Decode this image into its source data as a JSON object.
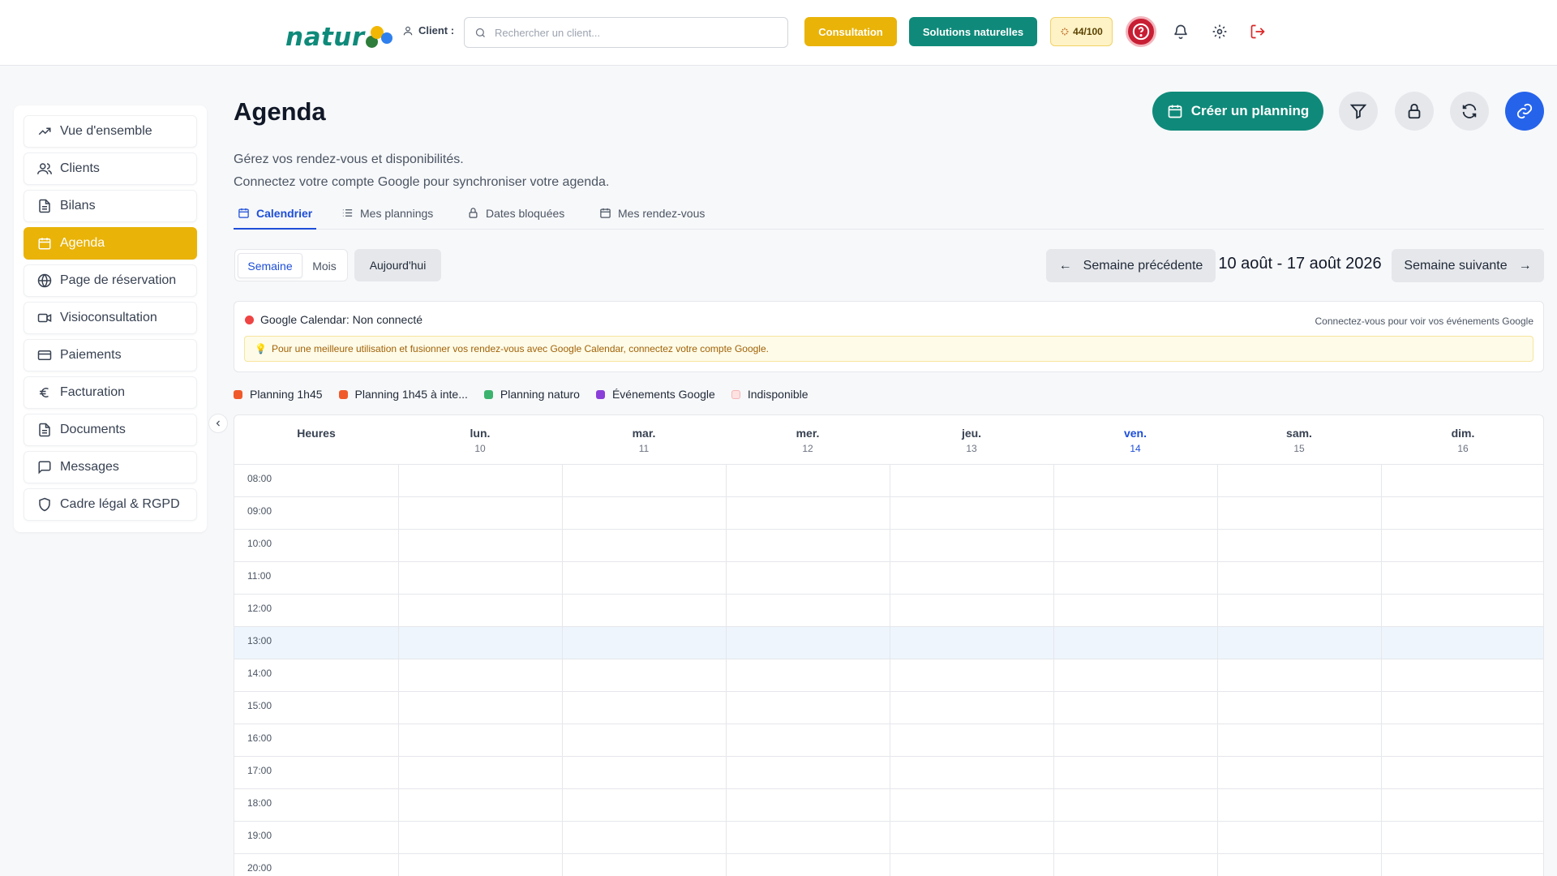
{
  "header": {
    "logo_text": "natur",
    "client_label": "Client :",
    "search_placeholder": "Rechercher un client...",
    "consultation_label": "Consultation",
    "solutions_label": "Solutions naturelles",
    "score": "44/100",
    "colors": {
      "brand_teal": "#0f8a7a",
      "brand_yellow": "#e9b308",
      "help_red": "#c81e34"
    }
  },
  "sidebar": {
    "items": [
      {
        "label": "Vue d'ensemble",
        "icon": "trending-up-icon"
      },
      {
        "label": "Clients",
        "icon": "users-icon"
      },
      {
        "label": "Bilans",
        "icon": "document-icon"
      },
      {
        "label": "Agenda",
        "icon": "calendar-icon",
        "active": true
      },
      {
        "label": "Page de réservation",
        "icon": "globe-icon"
      },
      {
        "label": "Visioconsultation",
        "icon": "video-icon"
      },
      {
        "label": "Paiements",
        "icon": "credit-card-icon"
      },
      {
        "label": "Facturation",
        "icon": "euro-icon"
      },
      {
        "label": "Documents",
        "icon": "document-icon"
      },
      {
        "label": "Messages",
        "icon": "message-icon"
      },
      {
        "label": "Cadre légal & RGPD",
        "icon": "shield-icon"
      }
    ]
  },
  "main": {
    "title": "Agenda",
    "subtitle_1": "Gérez vos rendez-vous et disponibilités.",
    "subtitle_2": "Connectez votre compte Google pour synchroniser votre agenda.",
    "create_label": "Créer un planning",
    "tabs": [
      {
        "label": "Calendrier",
        "icon": "calendar-icon",
        "active": true
      },
      {
        "label": "Mes plannings",
        "icon": "list-icon"
      },
      {
        "label": "Dates bloquées",
        "icon": "lock-icon"
      },
      {
        "label": "Mes rendez-vous",
        "icon": "calendar-icon"
      }
    ],
    "view": {
      "week": "Semaine",
      "month": "Mois",
      "selected": "Semaine",
      "today": "Aujourd'hui"
    },
    "nav": {
      "prev": "Semaine précédente",
      "next": "Semaine suivante",
      "range": "10 août - 17 août 2026"
    },
    "google": {
      "status": "Google Calendar: Non connecté",
      "hint": "Connectez-vous pour voir vos événements Google",
      "tip": "Pour une meilleure utilisation et fusionner vos rendez-vous avec Google Calendar, connectez votre compte Google."
    },
    "legend": [
      {
        "label": "Planning 1h45",
        "color": "#f05a2b"
      },
      {
        "label": "Planning 1h45 à inte...",
        "color": "#f05a2b"
      },
      {
        "label": "Planning naturo",
        "color": "#3bb36f"
      },
      {
        "label": "Événements Google",
        "color": "#8b3fd9"
      },
      {
        "label": "Indisponible",
        "color": "#fde2e2"
      }
    ],
    "calendar": {
      "hours_header": "Heures",
      "days": [
        {
          "name": "lun.",
          "num": "10"
        },
        {
          "name": "mar.",
          "num": "11"
        },
        {
          "name": "mer.",
          "num": "12"
        },
        {
          "name": "jeu.",
          "num": "13"
        },
        {
          "name": "ven.",
          "num": "14",
          "today": true
        },
        {
          "name": "sam.",
          "num": "15"
        },
        {
          "name": "dim.",
          "num": "16"
        }
      ],
      "hours": [
        "08:00",
        "09:00",
        "10:00",
        "11:00",
        "12:00",
        "13:00",
        "14:00",
        "15:00",
        "16:00",
        "17:00",
        "18:00",
        "19:00",
        "20:00"
      ],
      "highlighted_hour": "13:00"
    }
  }
}
